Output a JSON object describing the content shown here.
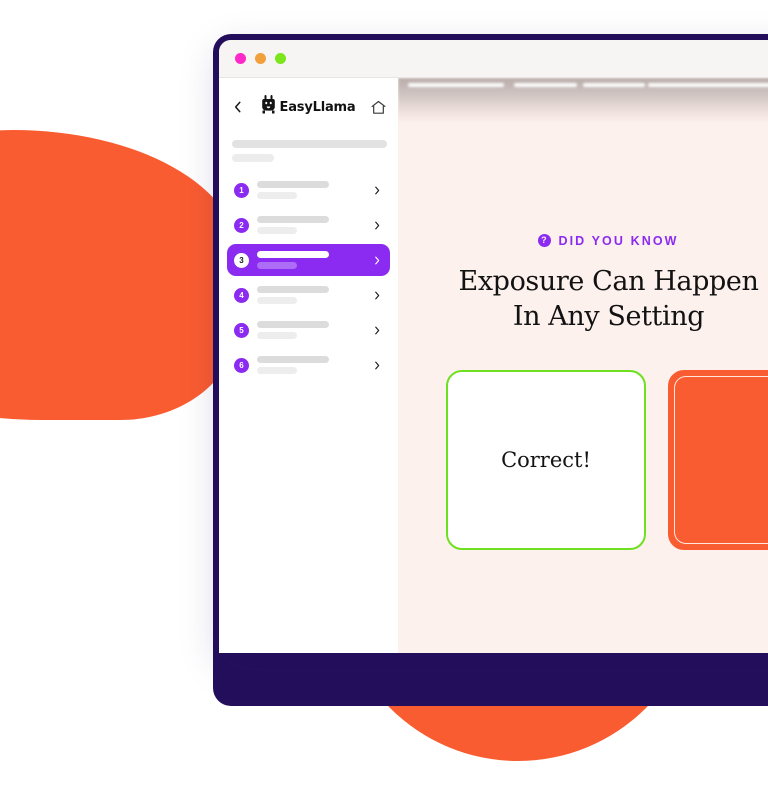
{
  "window": {
    "traffic_lights": [
      {
        "name": "close",
        "color": "#ff28c8"
      },
      {
        "name": "minimize",
        "color": "#f0a03c"
      },
      {
        "name": "zoom",
        "color": "#7ce51c"
      }
    ]
  },
  "sidebar": {
    "back_label": "‹",
    "brand_name": "EasyLlama",
    "home_label": "Home",
    "nav_items": [
      {
        "number": "1",
        "active": false
      },
      {
        "number": "2",
        "active": false
      },
      {
        "number": "3",
        "active": true
      },
      {
        "number": "4",
        "active": false
      },
      {
        "number": "5",
        "active": false
      },
      {
        "number": "6",
        "active": false
      }
    ]
  },
  "content": {
    "eyebrow_icon": "question-mark",
    "eyebrow": "DID YOU KNOW",
    "headline_line1": "Exposure Can Happen",
    "headline_line2": "In Any Setting",
    "cards": [
      {
        "label": "Correct!",
        "state": "correct",
        "accent": "#6fe021"
      },
      {
        "label": "",
        "state": "selected",
        "accent": "#fa5c31"
      }
    ]
  },
  "theme": {
    "purple": "#8b2bf2",
    "orange": "#fa5c31",
    "navy": "#240f5c",
    "green": "#6fe021",
    "content_bg": "#fdf1ee"
  }
}
